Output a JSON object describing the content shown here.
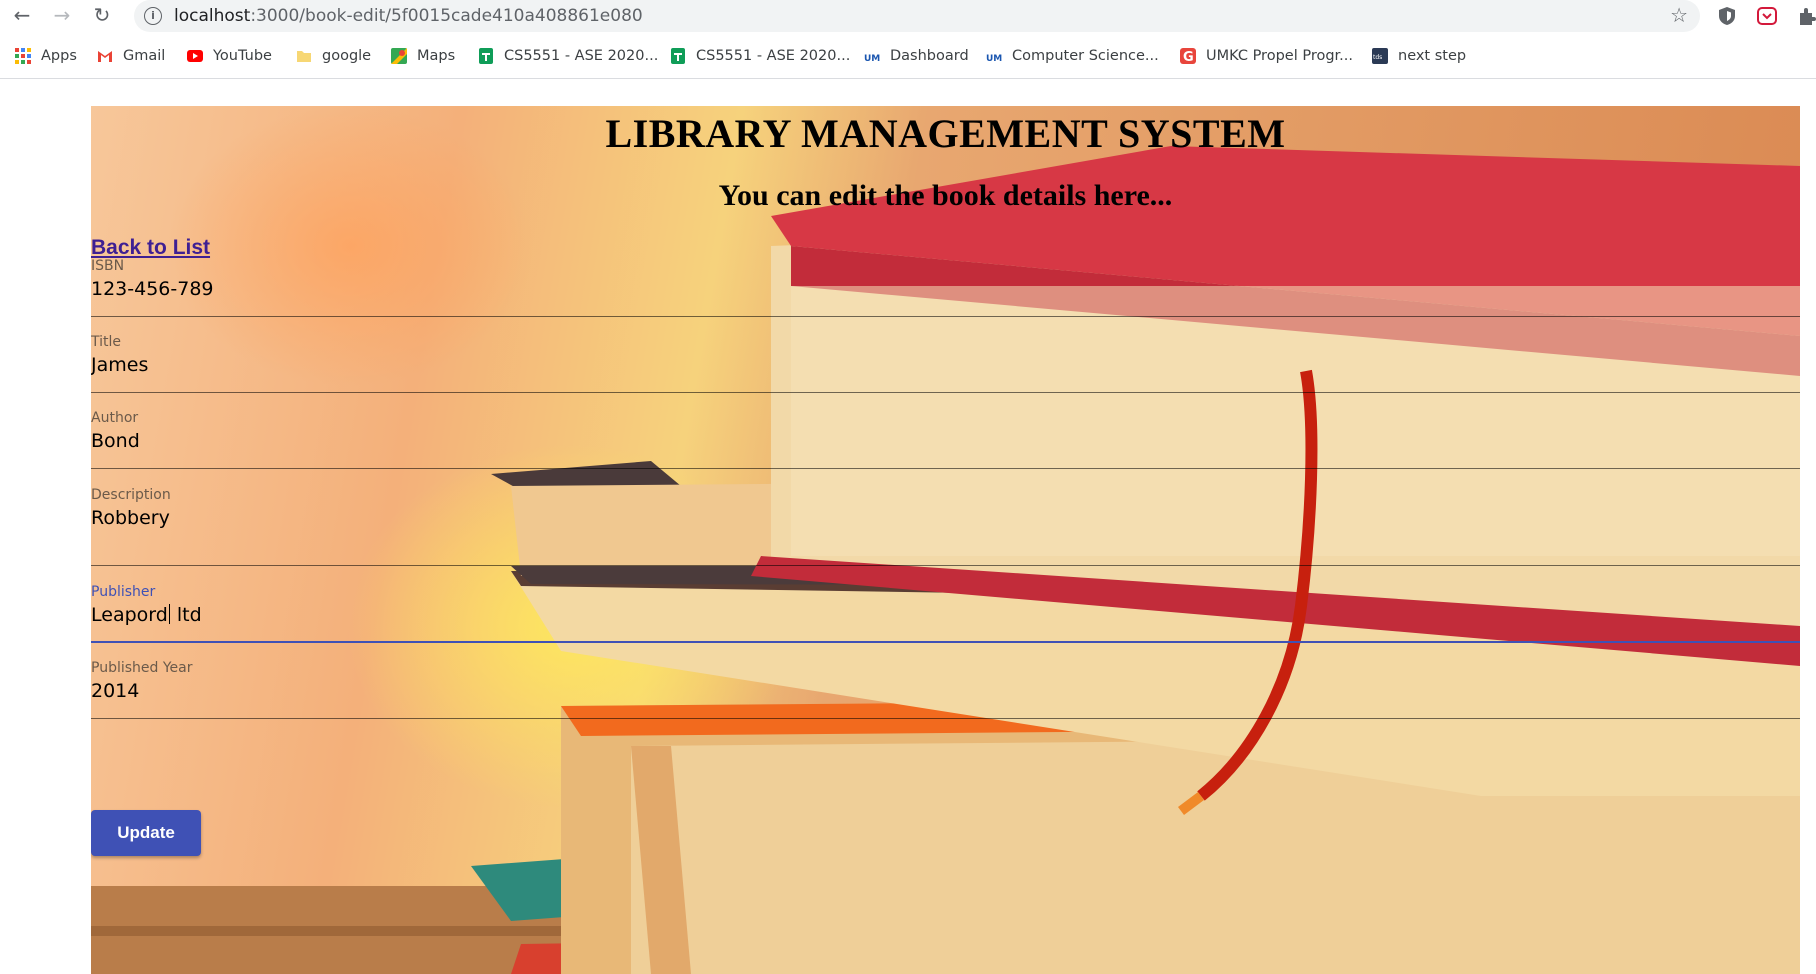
{
  "browser": {
    "url_host": "localhost",
    "url_path": ":3000/book-edit/5f0015cade410a408861e080",
    "bookmarks": [
      {
        "label": "Apps",
        "icon": "apps-grid-icon"
      },
      {
        "label": "Gmail",
        "icon": "gmail-icon"
      },
      {
        "label": "YouTube",
        "icon": "youtube-icon"
      },
      {
        "label": "google",
        "icon": "folder-icon"
      },
      {
        "label": "Maps",
        "icon": "maps-icon"
      },
      {
        "label": "CS5551 - ASE 2020...",
        "icon": "sheets-icon"
      },
      {
        "label": "CS5551 - ASE 2020...",
        "icon": "sheets-icon"
      },
      {
        "label": "Dashboard",
        "icon": "umkc-icon"
      },
      {
        "label": "Computer Science...",
        "icon": "umkc-icon"
      },
      {
        "label": "UMKC Propel Progr...",
        "icon": "g-icon"
      },
      {
        "label": "next step",
        "icon": "tds-icon"
      }
    ]
  },
  "page": {
    "title": "LIBRARY MANAGEMENT SYSTEM",
    "subtitle": "You can edit the book details here...",
    "back_link": "Back to List",
    "fields": {
      "isbn": {
        "label": "ISBN",
        "value": "123-456-789"
      },
      "title": {
        "label": "Title",
        "value": "James"
      },
      "author": {
        "label": "Author",
        "value": "Bond"
      },
      "description": {
        "label": "Description",
        "value": "Robbery"
      },
      "publisher": {
        "label": "Publisher",
        "value_before_caret": "Leapord",
        "value_after_caret": " ltd"
      },
      "published_year": {
        "label": "Published Year",
        "value": "2014"
      }
    },
    "update_label": "Update",
    "colors": {
      "accent": "#3f51b5",
      "link": "#3e1f93"
    }
  }
}
